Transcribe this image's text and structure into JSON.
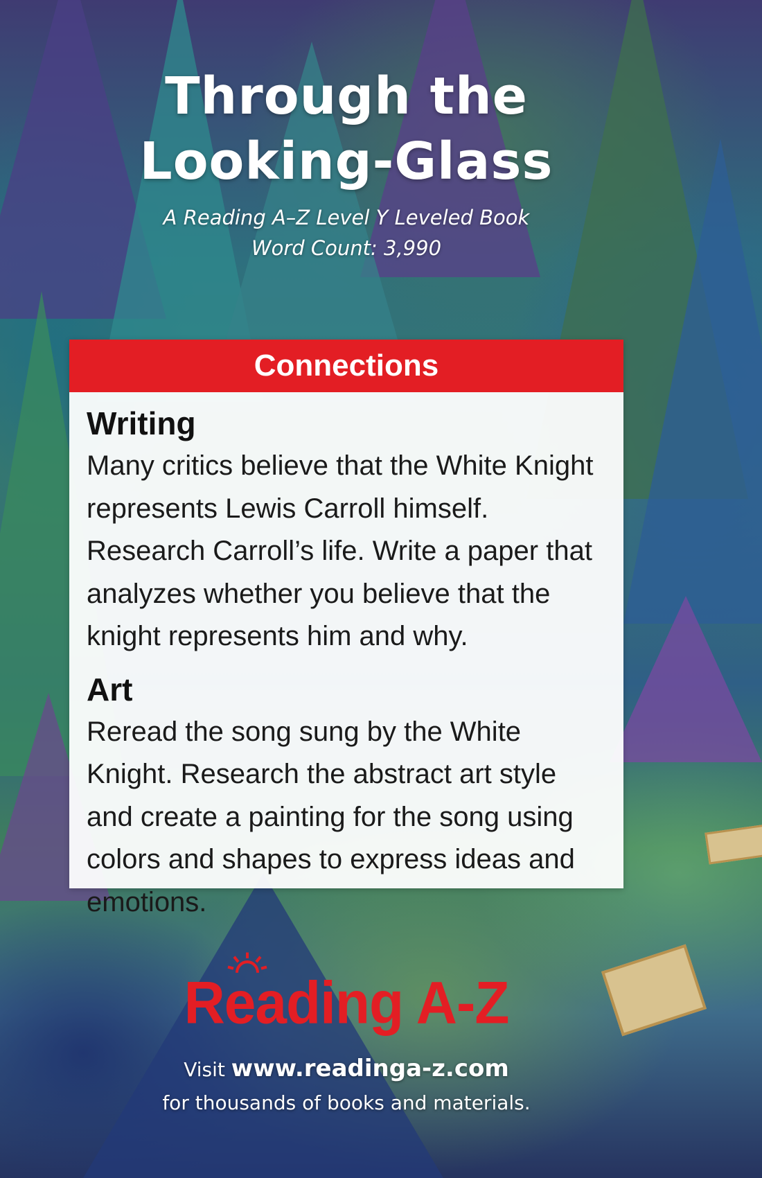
{
  "title": {
    "line1": "Through the",
    "line2": "Looking-Glass"
  },
  "subtitle": {
    "line1": "A Reading A–Z Level Y Leveled Book",
    "line2": "Word Count: 3,990"
  },
  "connections": {
    "header": "Connections",
    "sections": [
      {
        "heading": "Writing",
        "text": "Many critics believe that the White Knight represents Lewis Carroll himself. Research Carroll’s life. Write a paper that analyzes whether you believe that the knight represents him and why."
      },
      {
        "heading": "Art",
        "text": "Reread the song sung by the White Knight. Research the abstract art style and create a painting for the song using colors and shapes to express ideas and emotions."
      }
    ]
  },
  "footer": {
    "logo": "Reading A-Z",
    "visit_prefix": "Visit ",
    "url": "www.readinga-z.com",
    "tagline": "for thousands of books and materials."
  },
  "colors": {
    "accent_red": "#e31e24",
    "card_background": "#ffffff",
    "text_dark": "#1a1a1a"
  },
  "icons": {
    "logo_sun": "sun-rays-icon"
  }
}
